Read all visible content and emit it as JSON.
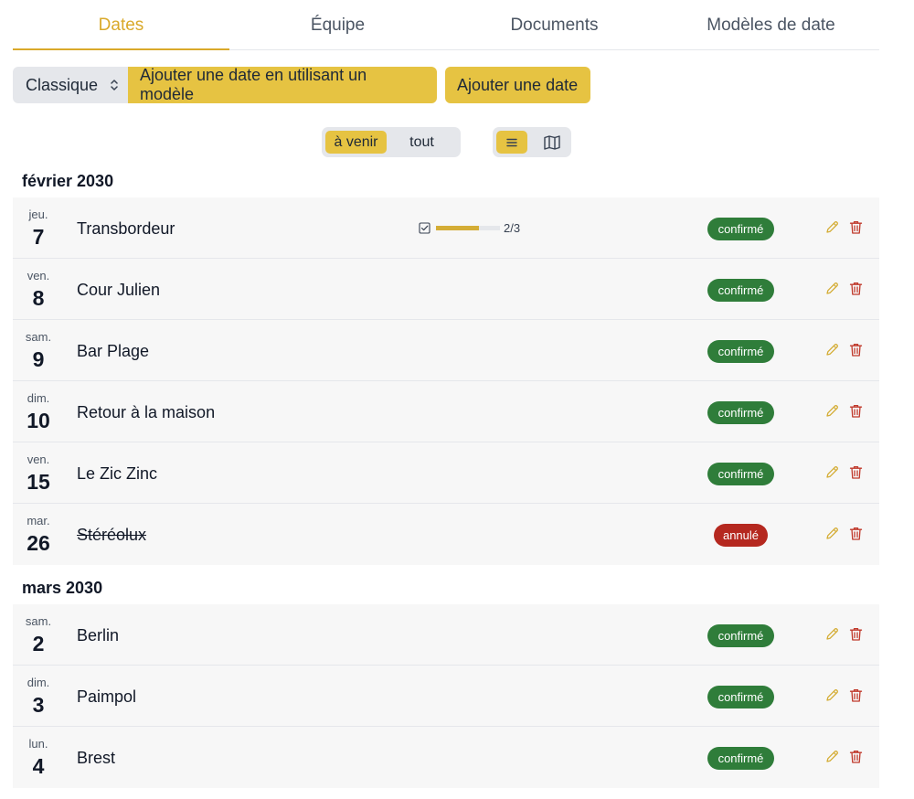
{
  "tabs": [
    {
      "label": "Dates",
      "active": true
    },
    {
      "label": "Équipe",
      "active": false
    },
    {
      "label": "Documents",
      "active": false
    },
    {
      "label": "Modèles de date",
      "active": false
    }
  ],
  "toolbar": {
    "select_value": "Classique",
    "template_button": "Ajouter une date en utilisant un modèle",
    "add_button": "Ajouter une date"
  },
  "filter": {
    "upcoming": "à venir",
    "all": "tout",
    "selected": "upcoming"
  },
  "view_toggle": {
    "selected": "list",
    "icons": [
      "list-icon",
      "map-icon"
    ]
  },
  "colors": {
    "accent": "#e6c342",
    "confirmed": "#2f7d3a",
    "cancelled": "#b5281f",
    "icon_edit": "#d4ad36",
    "icon_delete": "#c0392b"
  },
  "months": [
    {
      "label": "février 2030",
      "dates": [
        {
          "dow": "jeu.",
          "day": "7",
          "venue": "Transbordeur",
          "status": "confirmé",
          "status_type": "confirmed",
          "progress": {
            "done": 2,
            "total": 3,
            "text": "2/3"
          }
        },
        {
          "dow": "ven.",
          "day": "8",
          "venue": "Cour Julien",
          "status": "confirmé",
          "status_type": "confirmed"
        },
        {
          "dow": "sam.",
          "day": "9",
          "venue": "Bar Plage",
          "status": "confirmé",
          "status_type": "confirmed"
        },
        {
          "dow": "dim.",
          "day": "10",
          "venue": "Retour à la maison",
          "status": "confirmé",
          "status_type": "confirmed"
        },
        {
          "dow": "ven.",
          "day": "15",
          "venue": "Le Zic Zinc",
          "status": "confirmé",
          "status_type": "confirmed"
        },
        {
          "dow": "mar.",
          "day": "26",
          "venue": "Stéréolux",
          "status": "annulé",
          "status_type": "cancelled"
        }
      ]
    },
    {
      "label": "mars 2030",
      "dates": [
        {
          "dow": "sam.",
          "day": "2",
          "venue": "Berlin",
          "status": "confirmé",
          "status_type": "confirmed"
        },
        {
          "dow": "dim.",
          "day": "3",
          "venue": "Paimpol",
          "status": "confirmé",
          "status_type": "confirmed"
        },
        {
          "dow": "lun.",
          "day": "4",
          "venue": "Brest",
          "status": "confirmé",
          "status_type": "confirmed"
        }
      ]
    }
  ]
}
